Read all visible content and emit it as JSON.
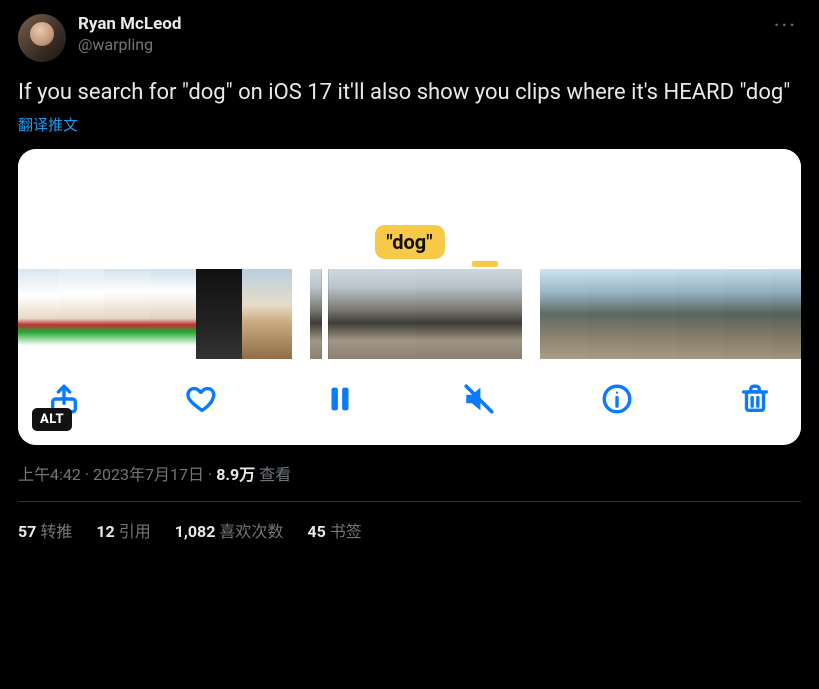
{
  "author": {
    "display_name": "Ryan McLeod",
    "handle": "@warpling"
  },
  "tweet_text": "If you search for \"dog\" on iOS 17 it'll also show you clips where it's HEARD \"dog\"",
  "translate_label": "翻译推文",
  "media": {
    "tooltip": "\"dog\"",
    "alt_badge": "ALT",
    "toolbar": {
      "share": "share-icon",
      "like": "heart-icon",
      "pause": "pause-icon",
      "mute": "mute-icon",
      "info": "info-icon",
      "trash": "trash-icon"
    }
  },
  "meta": {
    "time": "上午4:42",
    "date": "2023年7月17日",
    "views_n": "8.9万",
    "views_label": "查看"
  },
  "stats": {
    "retweet_n": "57",
    "retweet_label": "转推",
    "quote_n": "12",
    "quote_label": "引用",
    "like_n": "1,082",
    "like_label": "喜欢次数",
    "bookmark_n": "45",
    "bookmark_label": "书签"
  }
}
